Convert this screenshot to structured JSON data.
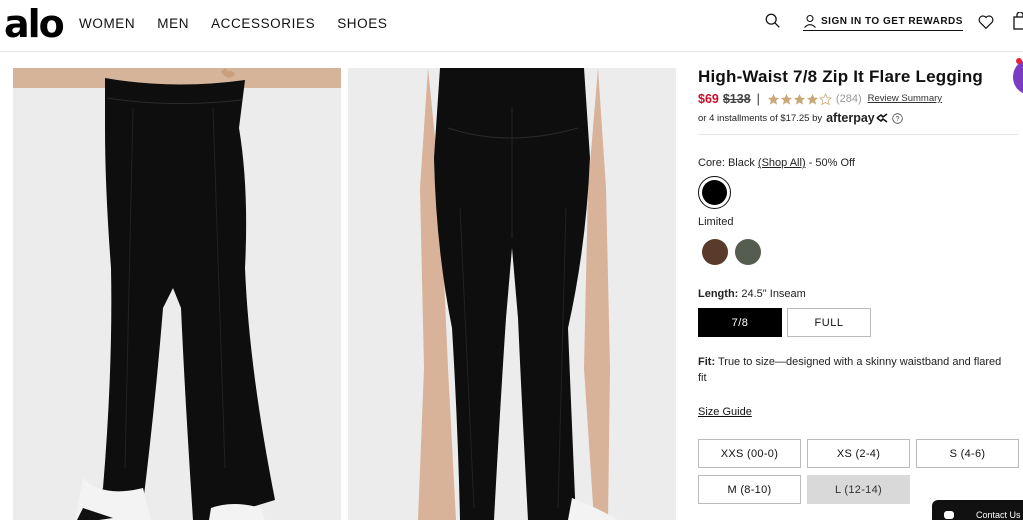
{
  "header": {
    "logo": "alo",
    "nav": [
      "WOMEN",
      "MEN",
      "ACCESSORIES",
      "SHOES"
    ],
    "signin_label": "SIGN IN TO GET REWARDS"
  },
  "product": {
    "title": "High-Waist 7/8 Zip It Flare Legging",
    "price": "$69",
    "original_price": "$138",
    "separator": "|",
    "rating": 4,
    "rating_max": 5,
    "review_count": "(284)",
    "review_link": "Review Summary",
    "installments_text": "or 4 installments of $17.25 by",
    "installments_brand": "afterpay",
    "color_label": "Core: Black",
    "shop_all": "(Shop All)",
    "discount_text": "- 50% Off",
    "limited_label": "Limited",
    "length_label": "Length:",
    "length_value": "24.5\" Inseam",
    "length_options": [
      "7/8",
      "FULL"
    ],
    "fit_label": "Fit:",
    "fit_text": "True to size—designed with a skinny waistband and flared fit",
    "size_guide": "Size Guide",
    "sizes": [
      "XXS (00-0)",
      "XS (2-4)",
      "S (4-6)",
      "M (8-10)",
      "L (12-14)"
    ]
  },
  "colors": {
    "price_red": "#c8102e",
    "star_color": "#c9a876",
    "swatch_black": "#000000",
    "swatch_brown": "#5a3a2a",
    "swatch_olive": "#555d50"
  },
  "chat": {
    "label": "Contact Us"
  }
}
